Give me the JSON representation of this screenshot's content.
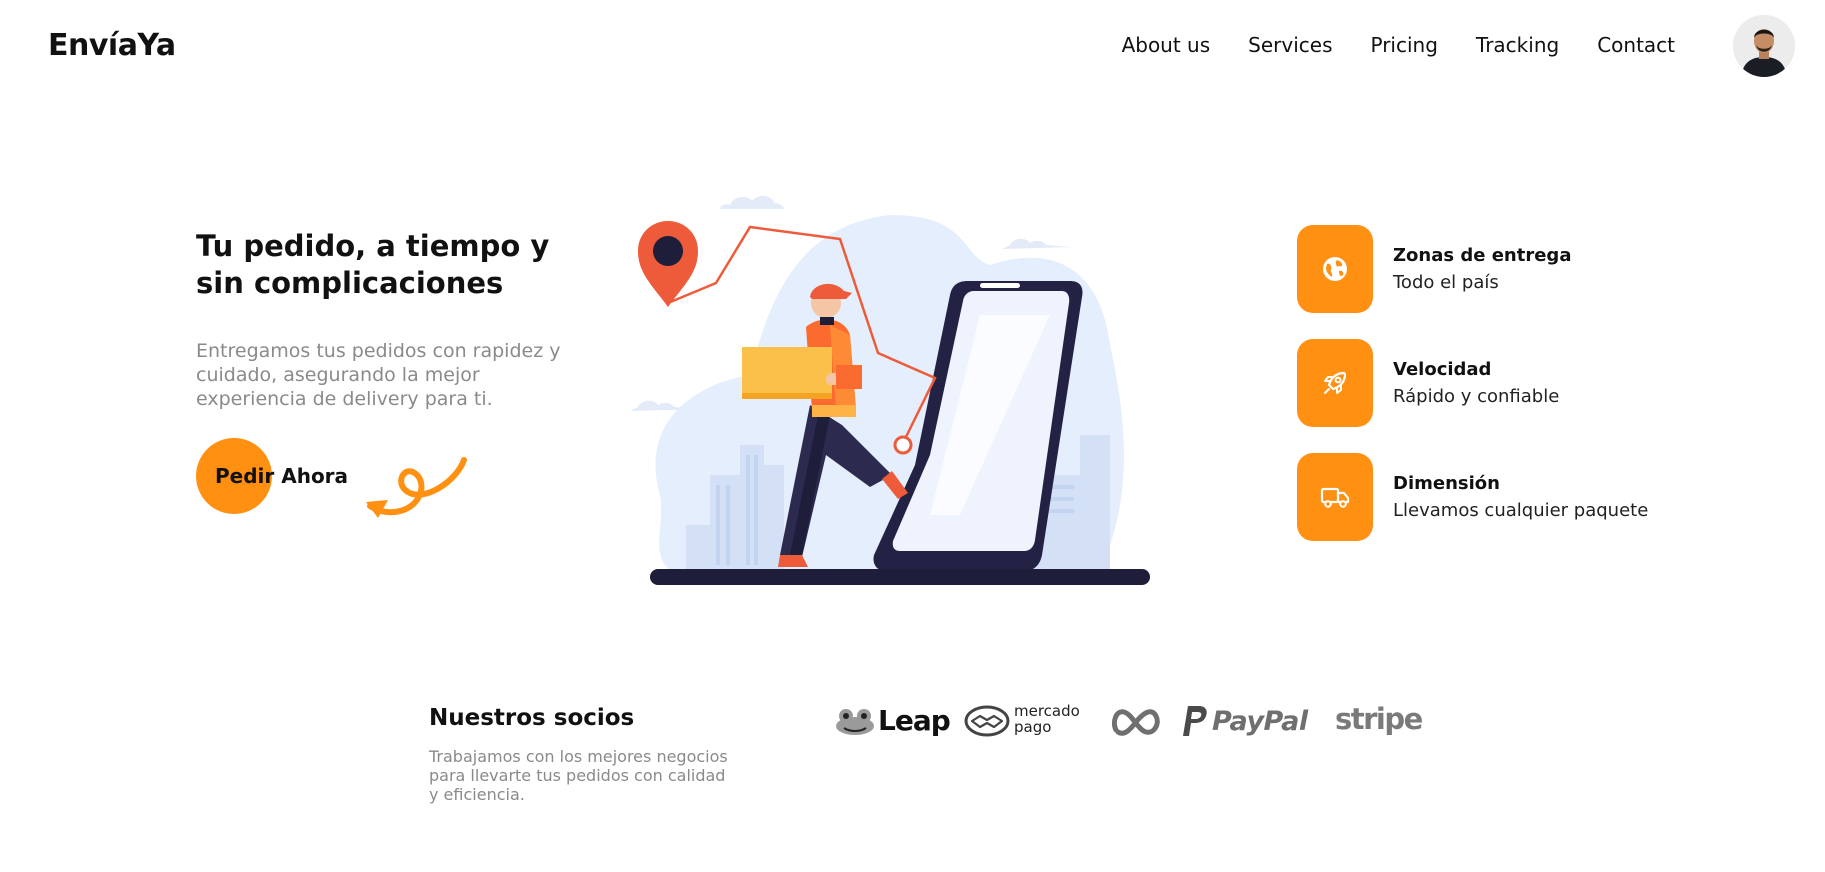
{
  "brand": {
    "name": "EnvíaYa"
  },
  "nav": {
    "items": [
      "About us",
      "Services",
      "Pricing",
      "Tracking",
      "Contact"
    ]
  },
  "hero": {
    "title": "Tu pedido, a tiempo y sin complicaciones",
    "subtitle": "Entregamos tus pedidos con rapidez y cuidado, asegurando la mejor experiencia de delivery para ti.",
    "cta_label": "Pedir Ahora"
  },
  "features": [
    {
      "icon": "globe-icon",
      "title": "Zonas de entrega",
      "text": "Todo el país"
    },
    {
      "icon": "rocket-icon",
      "title": "Velocidad",
      "text": "Rápido y confiable"
    },
    {
      "icon": "truck-icon",
      "title": "Dimensión",
      "text": "Llevamos cualquier paquete"
    }
  ],
  "partners": {
    "title": "Nuestros socios",
    "text": "Trabajamos con los mejores negocios para llevarte tus pedidos con calidad y eficiencia.",
    "logos": [
      "Leap",
      "mercado pago",
      "Meta",
      "PayPal",
      "stripe"
    ]
  },
  "colors": {
    "accent": "#ff9012",
    "navy": "#1e1d3a",
    "light_blue": "#e5eefc",
    "route": "#ee5b3b"
  }
}
